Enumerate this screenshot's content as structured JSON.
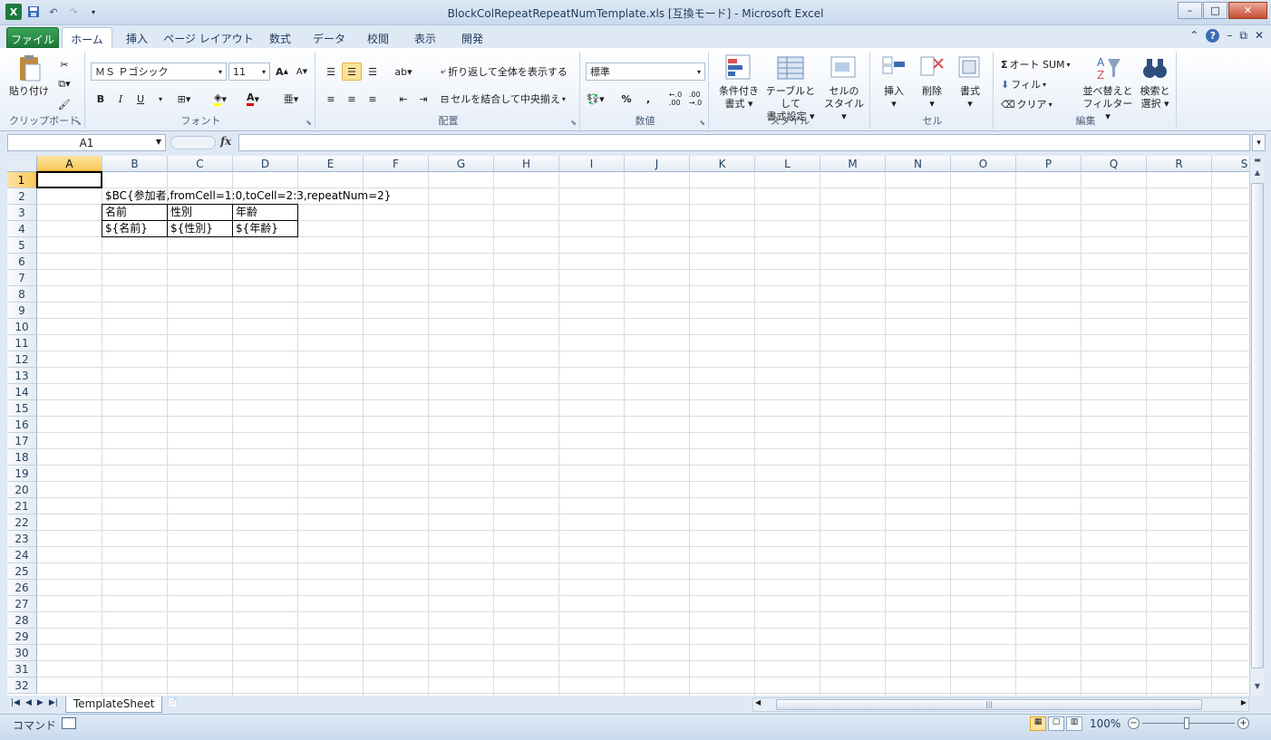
{
  "window": {
    "title": "BlockColRepeatRepeatNumTemplate.xls  [互換モード] - Microsoft Excel",
    "app_icon": "X",
    "controls": [
      "–",
      "□",
      "✕"
    ]
  },
  "qat": [
    "save-icon",
    "undo-icon",
    "redo-icon",
    "customize-icon"
  ],
  "tabs": [
    {
      "label": "ファイル"
    },
    {
      "label": "ホーム"
    },
    {
      "label": "挿入"
    },
    {
      "label": "ページ レイアウト"
    },
    {
      "label": "数式"
    },
    {
      "label": "データ"
    },
    {
      "label": "校閲"
    },
    {
      "label": "表示"
    },
    {
      "label": "開発"
    }
  ],
  "ribbon": {
    "clipboard": {
      "label": "クリップボード",
      "paste": "貼り付け"
    },
    "font": {
      "label": "フォント",
      "name": "ＭＳ Ｐゴシック",
      "size": "11",
      "bold": "B",
      "italic": "I",
      "underline": "U"
    },
    "alignment": {
      "label": "配置",
      "wrap": "折り返して全体を表示する",
      "merge": "セルを結合して中央揃え"
    },
    "number": {
      "label": "数値",
      "format": "標準",
      "percent": "%",
      "comma": ","
    },
    "styles": {
      "label": "スタイル",
      "cond_l1": "条件付き",
      "cond_l2": "書式",
      "table_l1": "テーブルとして",
      "table_l2": "書式設定",
      "cell_l1": "セルの",
      "cell_l2": "スタイル"
    },
    "cells": {
      "label": "セル",
      "insert": "挿入",
      "delete": "削除",
      "format": "書式"
    },
    "editing": {
      "label": "編集",
      "autosum": "オート SUM",
      "fill": "フィル",
      "clear": "クリア",
      "sort_l1": "並べ替えと",
      "sort_l2": "フィルター",
      "find_l1": "検索と",
      "find_l2": "選択"
    }
  },
  "formula_bar": {
    "name_box": "A1",
    "fx": "fx",
    "value": ""
  },
  "columns": [
    "A",
    "B",
    "C",
    "D",
    "E",
    "F",
    "G",
    "H",
    "I",
    "J",
    "K",
    "L",
    "M",
    "N",
    "O",
    "P",
    "Q",
    "R",
    "S"
  ],
  "rows": [
    "1",
    "2",
    "3",
    "4",
    "5",
    "6",
    "7",
    "8",
    "9",
    "10",
    "11",
    "12",
    "13",
    "14",
    "15",
    "16",
    "17",
    "18",
    "19",
    "20",
    "21",
    "22",
    "23",
    "24",
    "25",
    "26",
    "27",
    "28",
    "29",
    "30",
    "31",
    "32"
  ],
  "cells": {
    "B2": "$BC{参加者,fromCell=1:0,toCell=2:3,repeatNum=2}",
    "B3": "名前",
    "C3": "性別",
    "D3": "年齢",
    "B4": "${名前}",
    "C4": "${性別}",
    "D4": "${年齢}"
  },
  "sheets": [
    "TemplateSheet"
  ],
  "status": {
    "mode": "コマンド",
    "zoom": "100%"
  },
  "colors": {
    "file_tab": "#1e7b3a",
    "selection_header": "#f9c95b"
  }
}
